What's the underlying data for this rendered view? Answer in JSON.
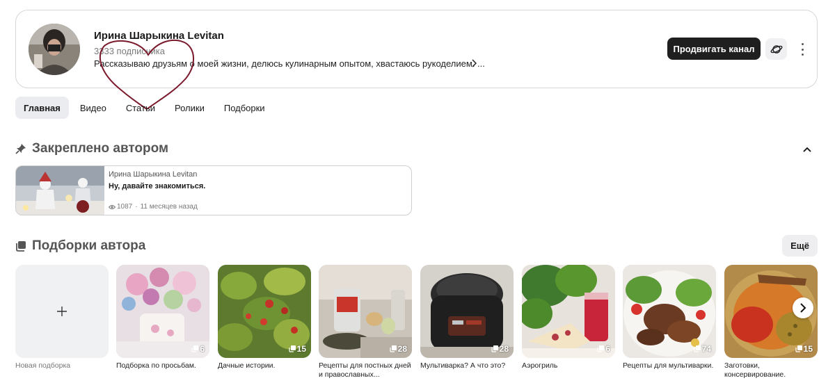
{
  "channel": {
    "name": "Ирина Шарыкина Levitan",
    "subscribers": "3333 подписчика",
    "description": "Рассказываю друзьям о моей жизни, делюсь кулинарным опытом, хвастаюсь рукоделием. ...",
    "promote_label": "Продвигать канал",
    "accent_color": "#1f1f1f",
    "heart_color": "#7a1a2c"
  },
  "tabs": [
    {
      "label": "Главная",
      "active": true
    },
    {
      "label": "Видео",
      "active": false
    },
    {
      "label": "Статьи",
      "active": false
    },
    {
      "label": "Ролики",
      "active": false
    },
    {
      "label": "Подборки",
      "active": false
    }
  ],
  "pinned": {
    "title": "Закреплено автором",
    "card": {
      "author": "Ирина Шарыкина Levitan",
      "title": "Ну, давайте знакомиться.",
      "views": "1087",
      "separator": "·",
      "time": "11 месяцев назад"
    }
  },
  "collections": {
    "title": "Подборки автора",
    "more_label": "Ещё",
    "new_label": "Новая подборка",
    "items": [
      {
        "caption": "Подборка по просьбам.",
        "count": "6"
      },
      {
        "caption": "Дачные истории.",
        "count": "15"
      },
      {
        "caption": "Рецепты для постных дней и православных...",
        "count": "28"
      },
      {
        "caption": "Мультиварка? А что это?",
        "count": "28"
      },
      {
        "caption": "Аэрогриль",
        "count": "6"
      },
      {
        "caption": "Рецепты для мультиварки.",
        "count": "74"
      },
      {
        "caption": "Заготовки, консервирование.",
        "count": "15"
      }
    ]
  }
}
